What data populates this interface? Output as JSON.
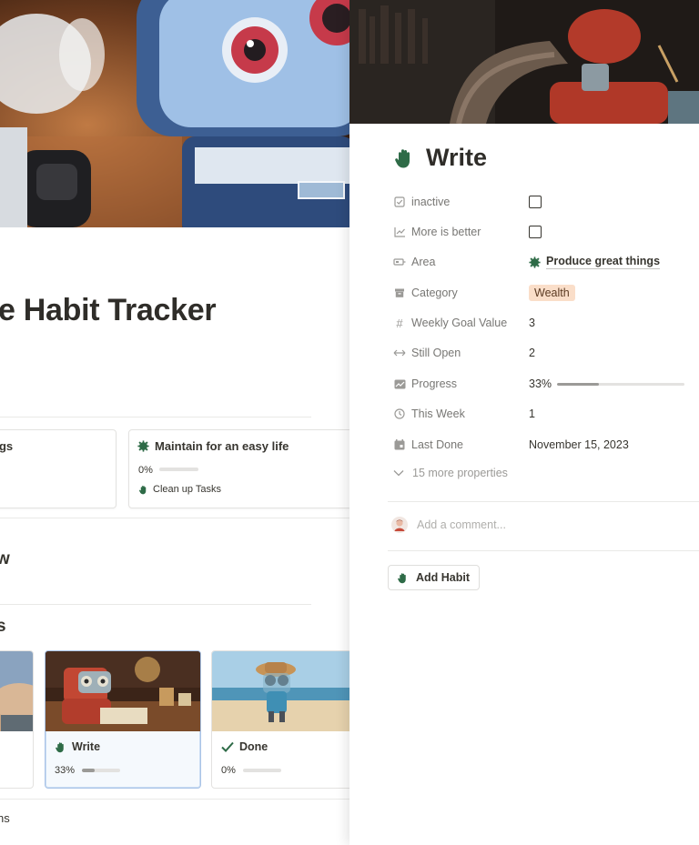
{
  "left_page": {
    "title": "e Habit Tracker",
    "area_cards": [
      {
        "title": "ngs"
      },
      {
        "title": "Maintain for an easy life",
        "progress_label": "0%",
        "progress": 0.0,
        "task": "Clean up Tasks"
      }
    ],
    "section_1": "w",
    "section_2": "s",
    "habit_cards": [
      {
        "title": "Write",
        "progress_label": "33%",
        "progress": 0.33,
        "icon": "hand-icon"
      },
      {
        "title": "Done",
        "progress_label": "0%",
        "progress": 0.0,
        "icon": "checkmark-icon"
      }
    ],
    "footer_partial": "ns"
  },
  "peek": {
    "title": "Write",
    "title_icon": "hand-icon",
    "properties": [
      {
        "label": "inactive",
        "icon": "checkbox-icon",
        "type": "checkbox",
        "checked": false
      },
      {
        "label": "More is better",
        "icon": "trend-icon",
        "type": "checkbox",
        "checked": false
      },
      {
        "label": "Area",
        "icon": "relation-icon",
        "type": "relation",
        "value": "Produce great things",
        "value_icon": "gear-icon"
      },
      {
        "label": "Category",
        "icon": "archive-icon",
        "type": "tag",
        "value": "Wealth"
      },
      {
        "label": "Weekly Goal Value",
        "icon": "hash-icon",
        "type": "text",
        "value": "3"
      },
      {
        "label": "Still Open",
        "icon": "arrows-icon",
        "type": "text",
        "value": "2"
      },
      {
        "label": "Progress",
        "icon": "chart-icon",
        "type": "progress",
        "value": "33%",
        "progress": 0.33
      },
      {
        "label": "This Week",
        "icon": "clock-icon",
        "type": "text",
        "value": "1"
      },
      {
        "label": "Last Done",
        "icon": "calendar-icon",
        "type": "text",
        "value": "November 15, 2023"
      }
    ],
    "more_properties": "15 more properties",
    "comment_placeholder": "Add a comment...",
    "add_habit_label": "Add Habit"
  },
  "colors": {
    "accent_green": "#2e6b47",
    "tag_wealth_bg": "#fadec9",
    "selected_border": "#a9c3e6"
  }
}
